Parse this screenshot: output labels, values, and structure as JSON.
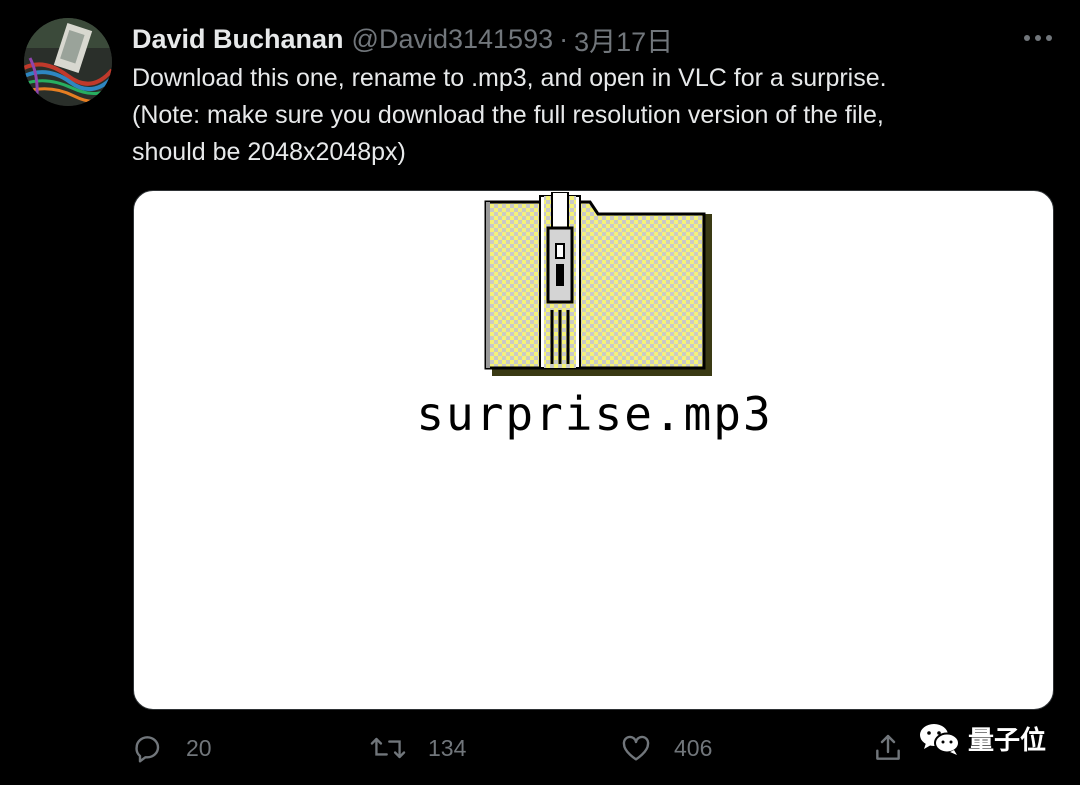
{
  "tweet": {
    "author_name": "David Buchanan",
    "author_handle": "@David3141593",
    "separator": "·",
    "timestamp": "3月17日",
    "text_lines": [
      "Download this one, rename to .mp3, and open in VLC for a surprise.",
      "(Note: make sure you download the full resolution version of the file,",
      "should be 2048x2048px)"
    ]
  },
  "media": {
    "file_name": "surprise.mp3",
    "icon": "zip-folder-icon"
  },
  "actions": {
    "reply_count": "20",
    "retweet_count": "134",
    "like_count": "406"
  },
  "watermark": {
    "text": "量子位",
    "icon": "wechat-icon"
  },
  "colors": {
    "background": "#000000",
    "text": "#e7e9ea",
    "muted": "#71767b",
    "card": "#ffffff",
    "folder_yellow": "#f4f27a"
  }
}
